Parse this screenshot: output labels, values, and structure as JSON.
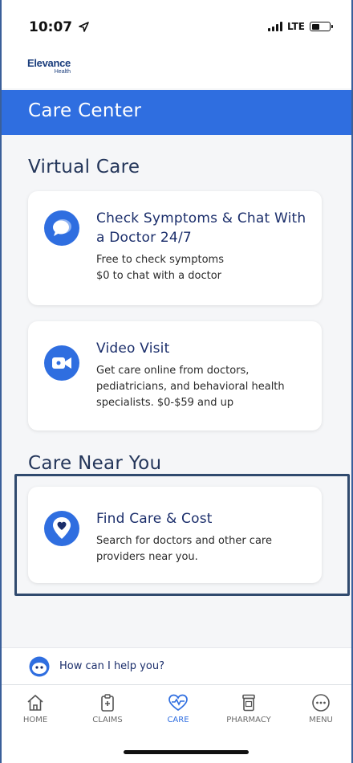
{
  "status": {
    "time": "10:07",
    "network": "LTE",
    "battery_percent": 45
  },
  "brand": {
    "name": "Elevance",
    "sub": "Health"
  },
  "header": {
    "title": "Care Center"
  },
  "sections": {
    "virtual_care": "Virtual Care",
    "care_near_you": "Care Near You"
  },
  "cards": [
    {
      "icon": "chat-bubble-icon",
      "title_lines": [
        "Check Symptoms & Chat With",
        "a Doctor 24/7"
      ],
      "text_lines": [
        "Free to check symptoms",
        "$0 to chat with a doctor"
      ]
    },
    {
      "icon": "video-camera-icon",
      "title_lines": [
        "Video Visit"
      ],
      "text_lines": [
        "Get care online from doctors,",
        "pediatricians, and behavioral health",
        "specialists. $0-$59 and up"
      ]
    },
    {
      "icon": "heart-pin-icon",
      "title_lines": [
        "Find Care & Cost"
      ],
      "text_lines": [
        "Search for doctors and other care",
        "providers near you."
      ]
    }
  ],
  "assistant": {
    "prompt": "How can I help you?"
  },
  "tabs": [
    {
      "label": "HOME",
      "icon": "home-icon",
      "active": false
    },
    {
      "label": "CLAIMS",
      "icon": "clipboard-icon",
      "active": false
    },
    {
      "label": "CARE",
      "icon": "heart-pulse-icon",
      "active": true
    },
    {
      "label": "PHARMACY",
      "icon": "pill-bottle-icon",
      "active": false
    },
    {
      "label": "MENU",
      "icon": "more-dots-icon",
      "active": false
    }
  ],
  "colors": {
    "brand_blue": "#2f6ee0",
    "navy_text": "#1b2e6b",
    "highlight_border": "#304a6e"
  }
}
